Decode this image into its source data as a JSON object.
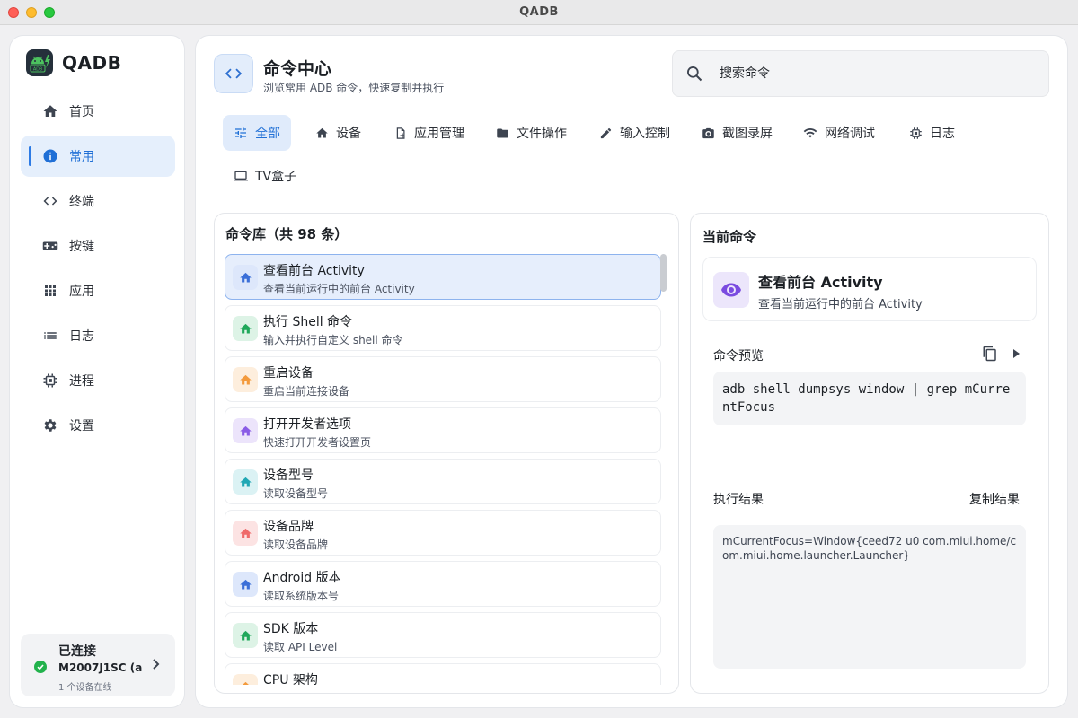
{
  "window": {
    "title": "QADB"
  },
  "brand": {
    "name": "QADB",
    "logo_text": "ADB"
  },
  "sidebar": {
    "items": [
      {
        "label": "首页",
        "icon": "home-icon"
      },
      {
        "label": "常用",
        "icon": "info-icon",
        "active": true
      },
      {
        "label": "终端",
        "icon": "code-icon"
      },
      {
        "label": "按键",
        "icon": "gamepad-icon"
      },
      {
        "label": "应用",
        "icon": "apps-grid-icon"
      },
      {
        "label": "日志",
        "icon": "list-icon"
      },
      {
        "label": "进程",
        "icon": "cpu-icon"
      },
      {
        "label": "设置",
        "icon": "gear-icon"
      }
    ]
  },
  "device": {
    "status": "已连接",
    "name": "M2007J1SC (a",
    "online": "1 个设备在线",
    "status_color": "#22b24c"
  },
  "header": {
    "title": "命令中心",
    "subtitle": "浏览常用 ADB 命令，快速复制并执行"
  },
  "search": {
    "placeholder": "搜索命令"
  },
  "tabs": [
    {
      "label": "全部",
      "icon": "sliders-icon",
      "active": true
    },
    {
      "label": "设备",
      "icon": "home-icon"
    },
    {
      "label": "应用管理",
      "icon": "app-file-icon"
    },
    {
      "label": "文件操作",
      "icon": "folder-icon"
    },
    {
      "label": "输入控制",
      "icon": "pencil-icon"
    },
    {
      "label": "截图录屏",
      "icon": "camera-icon"
    },
    {
      "label": "网络调试",
      "icon": "wifi-icon"
    },
    {
      "label": "日志",
      "icon": "bug-icon"
    },
    {
      "label": "TV盒子",
      "icon": "tv-icon"
    }
  ],
  "command_list": {
    "title_prefix": "命令库（共 ",
    "count": "98",
    "title_suffix": " 条）",
    "items": [
      {
        "name": "查看前台 Activity",
        "desc": "查看当前运行中的前台 Activity",
        "color": "#3b6fd8",
        "bg": "#dde7fb",
        "active": true
      },
      {
        "name": "执行 Shell 命令",
        "desc": "输入并执行自定义 shell 命令",
        "color": "#1fa85a",
        "bg": "#ddf3e6"
      },
      {
        "name": "重启设备",
        "desc": "重启当前连接设备",
        "color": "#f39a3c",
        "bg": "#fdeedd"
      },
      {
        "name": "打开开发者选项",
        "desc": "快速打开开发者设置页",
        "color": "#8a5ce6",
        "bg": "#ece4fb"
      },
      {
        "name": "设备型号",
        "desc": "读取设备型号",
        "color": "#20a7b4",
        "bg": "#dbf2f4"
      },
      {
        "name": "设备品牌",
        "desc": "读取设备品牌",
        "color": "#ef6a6a",
        "bg": "#fce3e3"
      },
      {
        "name": "Android 版本",
        "desc": "读取系统版本号",
        "color": "#3b6fd8",
        "bg": "#dde7fb"
      },
      {
        "name": "SDK 版本",
        "desc": "读取 API Level",
        "color": "#1fa85a",
        "bg": "#ddf3e6"
      },
      {
        "name": "CPU 架构",
        "desc": "",
        "color": "#f39a3c",
        "bg": "#fdeedd"
      }
    ]
  },
  "current": {
    "section_title": "当前命令",
    "name": "查看前台 Activity",
    "desc": "查看当前运行中的前台 Activity",
    "preview_label": "命令预览",
    "command": "adb shell dumpsys window | grep mCurrentFocus",
    "result_label": "执行结果",
    "copy_result_label": "复制结果",
    "result": "mCurrentFocus=Window{ceed72 u0 com.miui.home/com.miui.home.launcher.Launcher}"
  }
}
